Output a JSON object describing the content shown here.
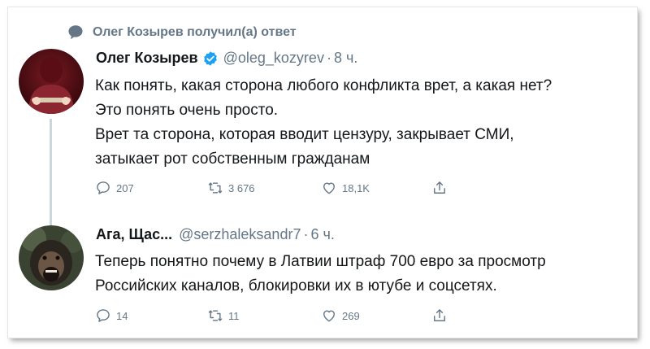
{
  "retweet_context": {
    "text": "Олег Козырев получил(а) ответ"
  },
  "tweets": [
    {
      "name": "Олег Козырев",
      "verified": true,
      "handle": "@oleg_kozyrev",
      "separator": "·",
      "time": "8 ч.",
      "lines": [
        "Как понять, какая сторона любого конфликта врет, а какая нет?",
        "Это понять очень просто.",
        "Врет та сторона, которая вводит цензуру, закрывает СМИ,",
        "затыкает рот собственным гражданам"
      ],
      "stats": {
        "replies": "207",
        "retweets": "3 676",
        "likes": "18,1K"
      }
    },
    {
      "name": "Ага, Щас...",
      "verified": false,
      "handle": "@serzhaleksandr7",
      "separator": "·",
      "time": "6 ч.",
      "lines": [
        "Теперь понятно почему в Латвии штраф 700 евро за просмотр",
        "Российских каналов, блокировки их в ютубе и соцсетях."
      ],
      "stats": {
        "replies": "14",
        "retweets": "11",
        "likes": "269"
      }
    }
  ],
  "colors": {
    "text": "#14171a",
    "secondary": "#657786",
    "verified": "#1da1f2",
    "thread_line": "#ccd6dd"
  },
  "icons": [
    "comment-bubble-icon",
    "verified-badge-icon",
    "reply-icon",
    "retweet-icon",
    "like-icon",
    "share-icon"
  ]
}
